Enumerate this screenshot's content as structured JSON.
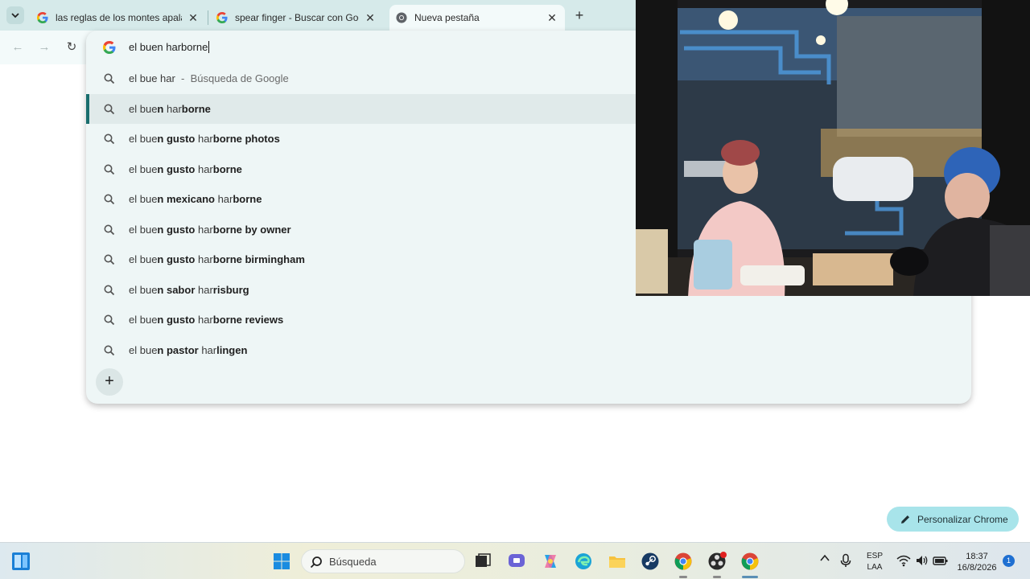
{
  "browser": {
    "tabs": [
      {
        "title": "las reglas de los montes apalac",
        "favicon": "google-icon",
        "active": false
      },
      {
        "title": "spear finger - Buscar con Goog",
        "favicon": "google-icon",
        "active": false
      },
      {
        "title": "Nueva pestaña",
        "favicon": "chrome-icon",
        "active": true
      }
    ],
    "close_glyph": "✕",
    "new_tab_glyph": "+",
    "tab_menu_glyph": "⌄"
  },
  "toolbar": {
    "back_glyph": "←",
    "forward_glyph": "→",
    "reload_glyph": "↻"
  },
  "omnibox": {
    "input_value": "el buen harborne",
    "suggestions": [
      {
        "parts": [
          {
            "t": "el bue har",
            "b": false
          },
          {
            "t": "  -  Búsqueda de Google",
            "b": false,
            "gray": true
          }
        ],
        "selected": false
      },
      {
        "parts": [
          {
            "t": "el bue",
            "b": false
          },
          {
            "t": "n",
            "b": true
          },
          {
            "t": " har",
            "b": false
          },
          {
            "t": "borne",
            "b": true
          }
        ],
        "selected": true
      },
      {
        "parts": [
          {
            "t": "el bue",
            "b": false
          },
          {
            "t": "n gusto",
            "b": true
          },
          {
            "t": " har",
            "b": false
          },
          {
            "t": "borne photos",
            "b": true
          }
        ],
        "selected": false
      },
      {
        "parts": [
          {
            "t": "el bue",
            "b": false
          },
          {
            "t": "n gusto",
            "b": true
          },
          {
            "t": " har",
            "b": false
          },
          {
            "t": "borne",
            "b": true
          }
        ],
        "selected": false
      },
      {
        "parts": [
          {
            "t": "el bue",
            "b": false
          },
          {
            "t": "n mexicano",
            "b": true
          },
          {
            "t": " har",
            "b": false
          },
          {
            "t": "borne",
            "b": true
          }
        ],
        "selected": false
      },
      {
        "parts": [
          {
            "t": "el bue",
            "b": false
          },
          {
            "t": "n gusto",
            "b": true
          },
          {
            "t": " har",
            "b": false
          },
          {
            "t": "borne by owner",
            "b": true
          }
        ],
        "selected": false
      },
      {
        "parts": [
          {
            "t": "el bue",
            "b": false
          },
          {
            "t": "n gusto",
            "b": true
          },
          {
            "t": " har",
            "b": false
          },
          {
            "t": "borne birmingham",
            "b": true
          }
        ],
        "selected": false
      },
      {
        "parts": [
          {
            "t": "el bue",
            "b": false
          },
          {
            "t": "n sabor",
            "b": true
          },
          {
            "t": " har",
            "b": false
          },
          {
            "t": "risburg",
            "b": true
          }
        ],
        "selected": false
      },
      {
        "parts": [
          {
            "t": "el bue",
            "b": false
          },
          {
            "t": "n gusto",
            "b": true
          },
          {
            "t": " har",
            "b": false
          },
          {
            "t": "borne reviews",
            "b": true
          }
        ],
        "selected": false
      },
      {
        "parts": [
          {
            "t": "el bue",
            "b": false
          },
          {
            "t": "n pastor",
            "b": true
          },
          {
            "t": " har",
            "b": false
          },
          {
            "t": "lingen",
            "b": true
          }
        ],
        "selected": false
      }
    ],
    "add_glyph": "+"
  },
  "customize": {
    "label": "Personalizar Chrome"
  },
  "taskbar": {
    "search_placeholder": "Búsqueda",
    "lang_top": "ESP",
    "lang_bottom": "LAA",
    "time": "18:37",
    "date": "16/8/2026",
    "notification_count": "1",
    "tray_chevron": "^"
  },
  "colors": {
    "tabstrip": "#d6eaea",
    "toolbar": "#f3fafa",
    "omnibox_selected_marker": "#1a6e6e",
    "customize_chip": "#a8e4ea",
    "notification_badge": "#1f6fd1"
  }
}
